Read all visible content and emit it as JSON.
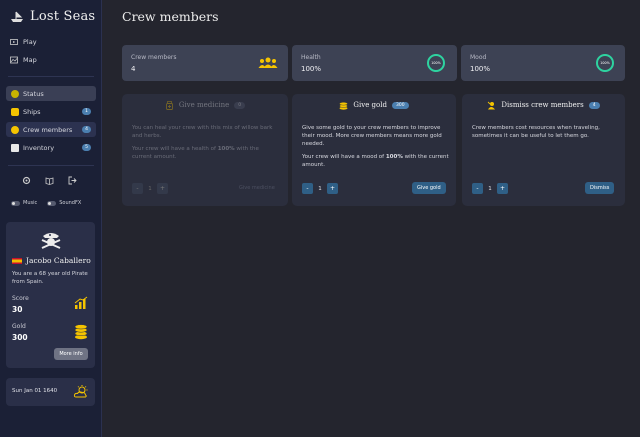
{
  "app": {
    "title": "Lost Seas"
  },
  "nav": [
    {
      "label": "Play",
      "icon": "play-icon"
    },
    {
      "label": "Map",
      "icon": "map-icon"
    }
  ],
  "sections": [
    {
      "label": "Status",
      "icon": "status-icon",
      "badge": ""
    },
    {
      "label": "Ships",
      "icon": "ship-icon",
      "badge": "1"
    },
    {
      "label": "Crew members",
      "icon": "crew-icon",
      "badge": "4"
    },
    {
      "label": "Inventory",
      "icon": "inventory-icon",
      "badge": "5"
    }
  ],
  "toggles": {
    "music": "Music",
    "soundfx": "SoundFX"
  },
  "player": {
    "name": "Jacobo Caballero",
    "bio": "You are a 68 year old Pirate from Spain.",
    "score_label": "Score",
    "score": "30",
    "gold_label": "Gold",
    "gold": "300",
    "more_label": "More info"
  },
  "date": "Sun Jan 01 1640",
  "page": {
    "title": "Crew members"
  },
  "stats": {
    "crew_label": "Crew members",
    "crew_value": "4",
    "health_label": "Health",
    "health_value": "100%",
    "health_ring": "100%",
    "mood_label": "Mood",
    "mood_value": "100%",
    "mood_ring": "100%"
  },
  "cards": {
    "medicine": {
      "title": "Give medicine",
      "badge": "0",
      "p1": "You can heal your crew with this mix of willow bark and herbs.",
      "p2_pre": "Your crew will have a health of ",
      "p2_val": "100%",
      "p2_post": " with the current amount.",
      "qty": "1",
      "minus": "-",
      "plus": "+",
      "action": "Give medicine"
    },
    "gold": {
      "title": "Give gold",
      "badge": "300",
      "p1": "Give some gold to your crew members to improve their mood. More crew members means more gold needed.",
      "p2_pre": "Your crew will have a mood of ",
      "p2_val": "100%",
      "p2_post": " with the current amount.",
      "qty": "1",
      "minus": "-",
      "plus": "+",
      "action": "Give gold"
    },
    "dismiss": {
      "title": "Dismiss crew members",
      "badge": "4",
      "p1": "Crew members cost resources when traveling, sometimes it can be useful to let them go.",
      "qty": "1",
      "minus": "-",
      "plus": "+",
      "action": "Dismiss"
    }
  },
  "colors": {
    "accent": "#2f5f86",
    "badge": "#4b7fb0",
    "ring": "#2ed3a0",
    "gold": "#f5c400"
  }
}
